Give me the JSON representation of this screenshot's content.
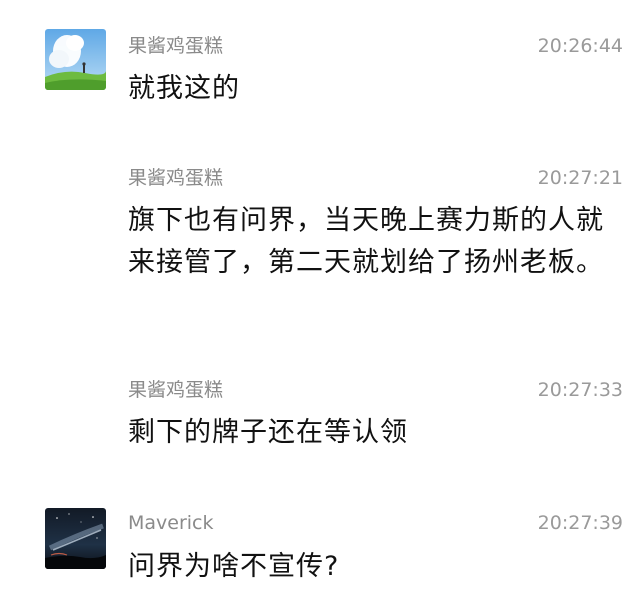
{
  "messages": [
    {
      "sender": "果酱鸡蛋糕",
      "time": "20:26:44",
      "text": "就我这的",
      "avatar": "sky-field-avatar"
    },
    {
      "sender": "果酱鸡蛋糕",
      "time": "20:27:21",
      "text": "旗下也有问界，当天晚上赛力斯的人就来接管了，第二天就划给了扬州老板。"
    },
    {
      "sender": "果酱鸡蛋糕",
      "time": "20:27:33",
      "text": "剩下的牌子还在等认领"
    },
    {
      "sender": "Maverick",
      "time": "20:27:39",
      "text": "问界为啥不宣传?",
      "avatar": "night-sky-avatar"
    }
  ]
}
